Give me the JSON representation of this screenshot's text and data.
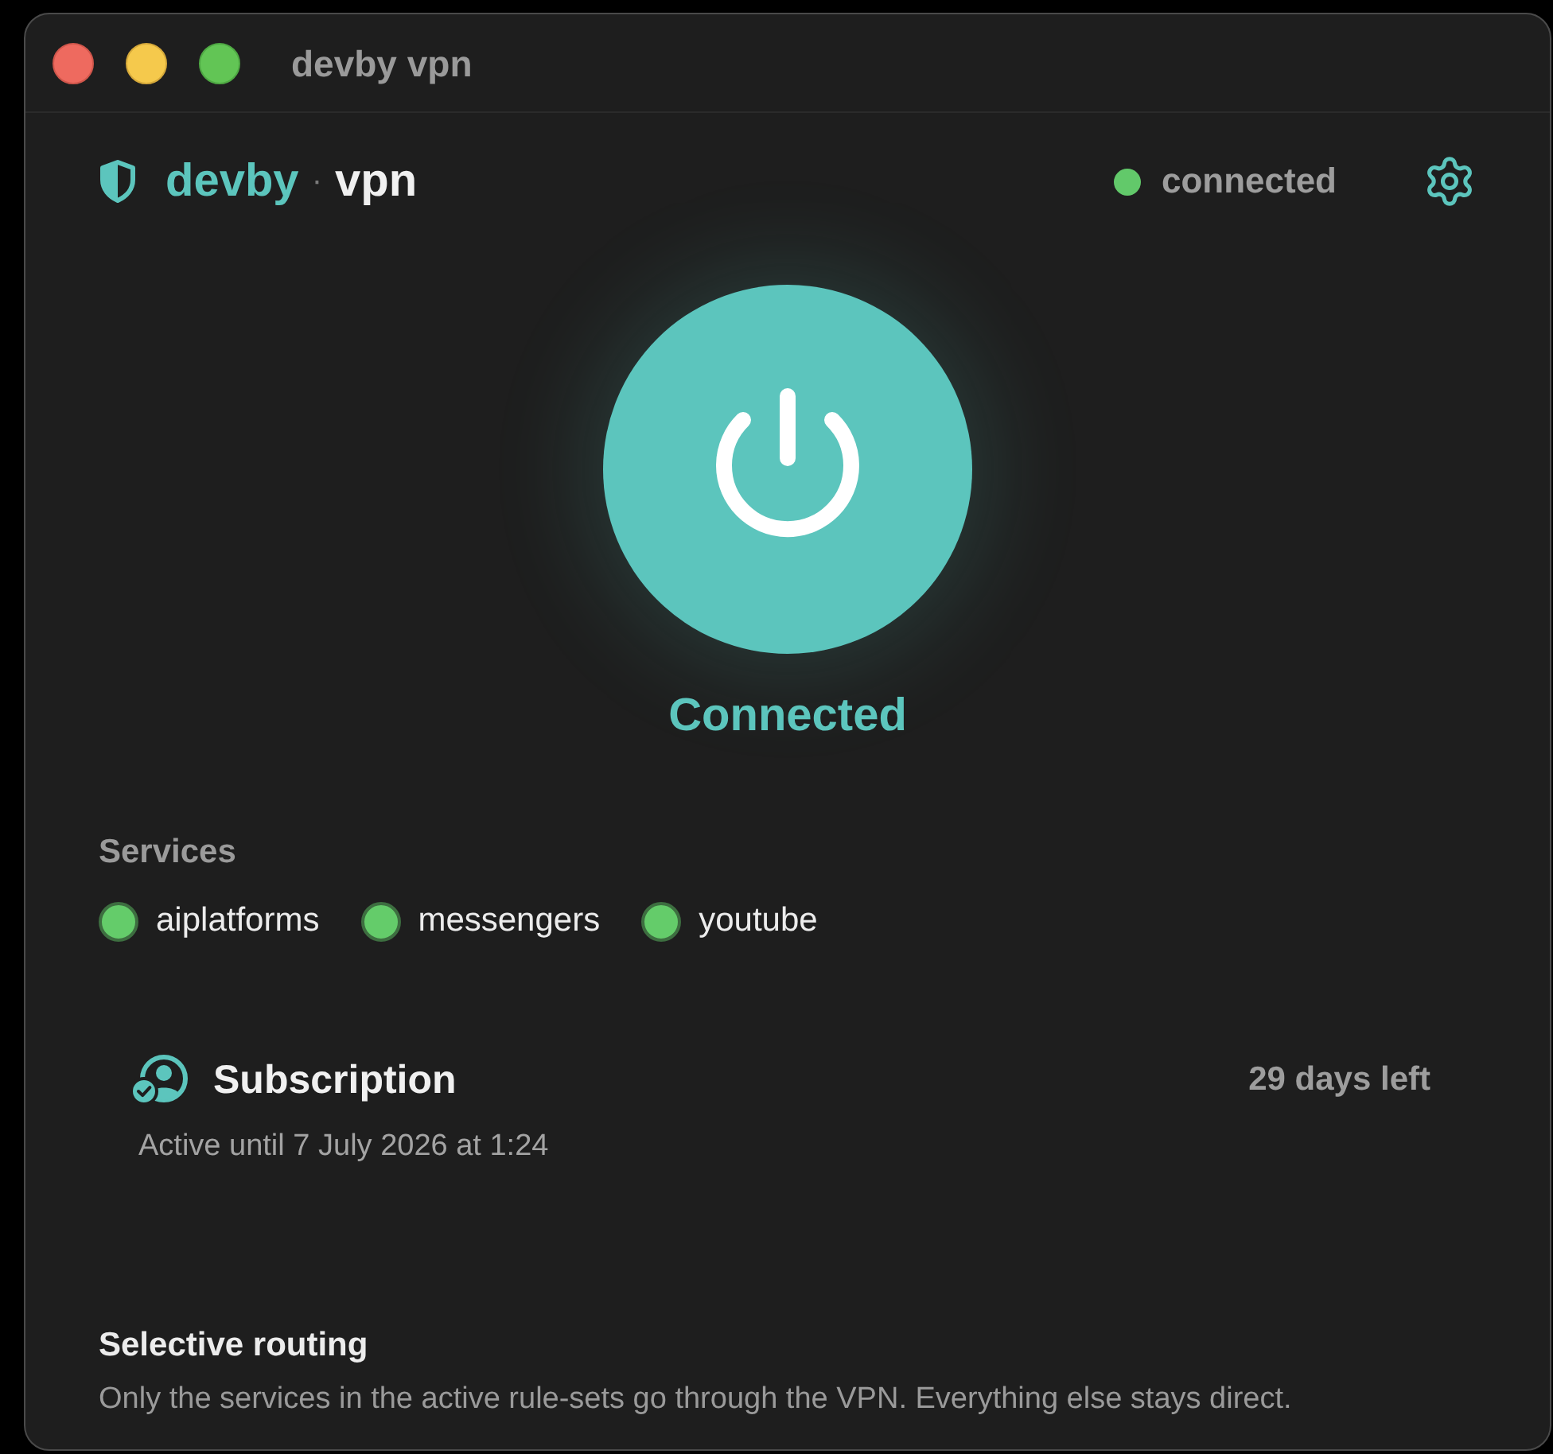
{
  "window": {
    "title": "devby vpn"
  },
  "header": {
    "brand": "devby",
    "separator": "·",
    "product": "vpn",
    "status": {
      "label": "connected",
      "on": true
    }
  },
  "power": {
    "on": true,
    "label": "Connected"
  },
  "services": {
    "title": "Services",
    "items": [
      {
        "label": "aiplatforms",
        "enabled": true
      },
      {
        "label": "messengers",
        "enabled": true
      },
      {
        "label": "youtube",
        "enabled": true
      }
    ]
  },
  "subscription": {
    "title": "Subscription",
    "remaining": "29 days left",
    "detail": "Active until 7 July 2026 at 1:24"
  },
  "routing": {
    "title": "Selective routing",
    "description": "Only the services in the active rule-sets go through the VPN. Everything else stays direct."
  }
}
